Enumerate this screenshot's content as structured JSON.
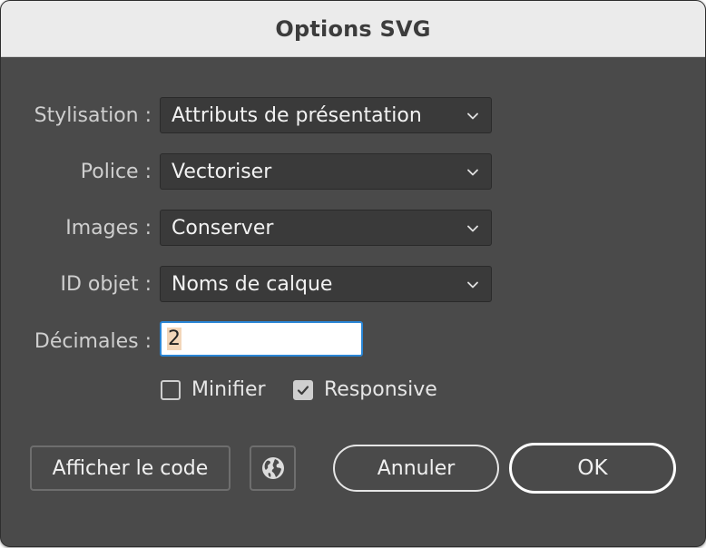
{
  "dialog": {
    "title": "Options SVG"
  },
  "fields": [
    {
      "label": "Stylisation :",
      "value": "Attributs de présentation"
    },
    {
      "label": "Police :",
      "value": "Vectoriser"
    },
    {
      "label": "Images :",
      "value": "Conserver"
    },
    {
      "label": "ID objet :",
      "value": "Noms de calque"
    }
  ],
  "decimals": {
    "label": "Décimales :",
    "value": "2"
  },
  "checkboxes": {
    "minify": {
      "label": "Minifier",
      "checked": false
    },
    "responsive": {
      "label": "Responsive",
      "checked": true
    }
  },
  "buttons": {
    "show_code": "Afficher le code",
    "cancel": "Annuler",
    "ok": "OK"
  },
  "icons": {
    "dropdown": "chevron-down-icon",
    "checkmark": "checkmark-icon",
    "browser": "globe-icon"
  },
  "colors": {
    "dialog_bg": "#4a4a4a",
    "titlebar_bg": "#ebebeb",
    "select_bg": "#3a3a3a",
    "focus_ring": "#2a86d6"
  }
}
